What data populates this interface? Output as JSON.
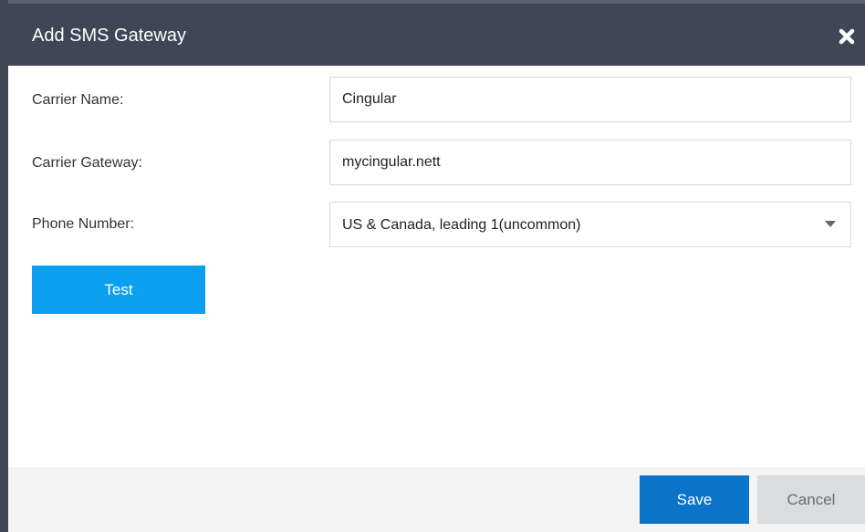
{
  "dialog": {
    "title": "Add SMS Gateway",
    "close_icon": "close-x-icon"
  },
  "form": {
    "carrier_name": {
      "label": "Carrier Name:",
      "value": "Cingular"
    },
    "carrier_gateway": {
      "label": "Carrier Gateway:",
      "value": "mycingular.nett"
    },
    "phone_number": {
      "label": "Phone Number:",
      "selected": "US & Canada, leading 1(uncommon)",
      "icon": "chevron-down-icon"
    },
    "test_label": "Test"
  },
  "footer": {
    "save_label": "Save",
    "cancel_label": "Cancel"
  },
  "colors": {
    "header": "#3f4756",
    "test_button": "#0b9ff0",
    "save_button": "#0b73c8",
    "cancel_button": "#d9dde0"
  }
}
